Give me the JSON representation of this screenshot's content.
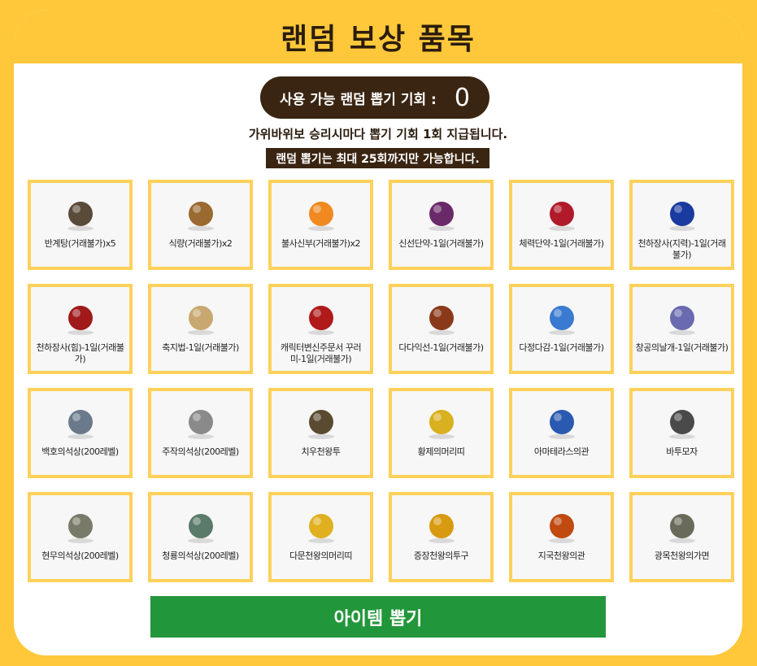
{
  "header": {
    "title": "랜덤 보상 품목"
  },
  "chance": {
    "label": "사용 가능 랜덤 뽑기 기회 :",
    "count": "0"
  },
  "notice": {
    "line1": "가위바위보 승리시마다 뽑기 기회 1회 지급됩니다.",
    "line2": "랜덤 뽑기는 최대 25회까지만 가능합니다."
  },
  "items": [
    {
      "label": "반계탕(거래불가)x5",
      "icon": "pot-icon",
      "color": "#5a4a3a"
    },
    {
      "label": "식량(거래불가)x2",
      "icon": "sack-icon",
      "color": "#9a6a30"
    },
    {
      "label": "불사신부(거래불가)x2",
      "icon": "talisman-icon",
      "color": "#f08a20"
    },
    {
      "label": "신선단약-1일(거래불가)",
      "icon": "orbs-icon",
      "color": "#6a2a6a"
    },
    {
      "label": "체력단약-1일(거래불가)",
      "icon": "red-orbs-icon",
      "color": "#b01a2a"
    },
    {
      "label": "천하장사(지력)-1일(거래불가)",
      "icon": "blue-orb-icon",
      "color": "#1a3aa0"
    },
    {
      "label": "천하장사(힘)-1일(거래불가)",
      "icon": "red-orb-icon",
      "color": "#a01a1a"
    },
    {
      "label": "축지법-1일(거래불가)",
      "icon": "scroll-icon",
      "color": "#c8a870"
    },
    {
      "label": "캐릭터변신주문서 꾸러미-1일(거래불가)",
      "icon": "pouch-icon",
      "color": "#b01a1a"
    },
    {
      "label": "다다익선-1일(거래불가)",
      "icon": "food-tray-icon",
      "color": "#8a3a1a"
    },
    {
      "label": "다정다감-1일(거래불가)",
      "icon": "potion-icon",
      "color": "#3a7ad0"
    },
    {
      "label": "창공의날개-1일(거래불가)",
      "icon": "wings-icon",
      "color": "#6a6ab0"
    },
    {
      "label": "백호의석상(200레벨)",
      "icon": "tiger-statue-icon",
      "color": "#6a7a8a"
    },
    {
      "label": "주작의석상(200레벨)",
      "icon": "phoenix-statue-icon",
      "color": "#8a8a8a"
    },
    {
      "label": "치우천왕투",
      "icon": "helmet-icon",
      "color": "#5a4a30"
    },
    {
      "label": "황제의머리띠",
      "icon": "headband-icon",
      "color": "#d8b020"
    },
    {
      "label": "아마테라스의관",
      "icon": "crown-icon",
      "color": "#2a5ab0"
    },
    {
      "label": "바투모자",
      "icon": "hat-icon",
      "color": "#4a4a4a"
    },
    {
      "label": "현무의석상(200레벨)",
      "icon": "turtle-statue-icon",
      "color": "#7a7a6a"
    },
    {
      "label": "청룡의석상(200레벨)",
      "icon": "dragon-statue-icon",
      "color": "#5a7a6a"
    },
    {
      "label": "다문천왕의머리띠",
      "icon": "gold-headband-icon",
      "color": "#e0b020"
    },
    {
      "label": "증장천왕의투구",
      "icon": "gold-helmet-icon",
      "color": "#d89a10"
    },
    {
      "label": "지국천왕의관",
      "icon": "fire-crown-icon",
      "color": "#c04a10"
    },
    {
      "label": "광목천왕의가면",
      "icon": "mask-icon",
      "color": "#6a6a5a"
    }
  ],
  "draw_button": {
    "label": "아이템 뽑기"
  }
}
